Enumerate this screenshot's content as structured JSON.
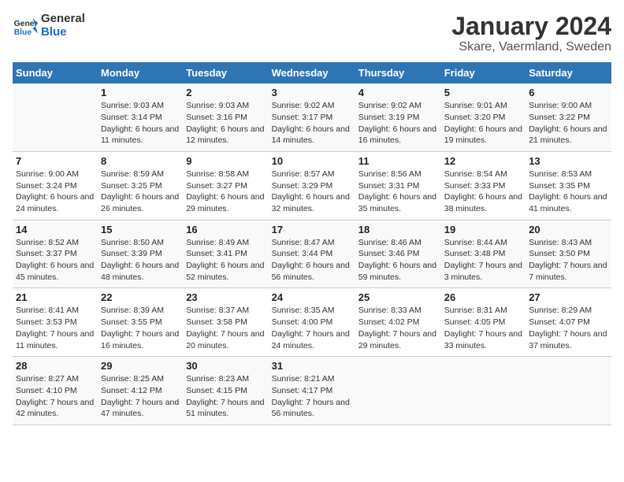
{
  "logo": {
    "text_general": "General",
    "text_blue": "Blue"
  },
  "title": "January 2024",
  "subtitle": "Skare, Vaermland, Sweden",
  "columns": [
    "Sunday",
    "Monday",
    "Tuesday",
    "Wednesday",
    "Thursday",
    "Friday",
    "Saturday"
  ],
  "weeks": [
    [
      {
        "day": "",
        "sunrise": "",
        "sunset": "",
        "daylight": ""
      },
      {
        "day": "1",
        "sunrise": "Sunrise: 9:03 AM",
        "sunset": "Sunset: 3:14 PM",
        "daylight": "Daylight: 6 hours and 11 minutes."
      },
      {
        "day": "2",
        "sunrise": "Sunrise: 9:03 AM",
        "sunset": "Sunset: 3:16 PM",
        "daylight": "Daylight: 6 hours and 12 minutes."
      },
      {
        "day": "3",
        "sunrise": "Sunrise: 9:02 AM",
        "sunset": "Sunset: 3:17 PM",
        "daylight": "Daylight: 6 hours and 14 minutes."
      },
      {
        "day": "4",
        "sunrise": "Sunrise: 9:02 AM",
        "sunset": "Sunset: 3:19 PM",
        "daylight": "Daylight: 6 hours and 16 minutes."
      },
      {
        "day": "5",
        "sunrise": "Sunrise: 9:01 AM",
        "sunset": "Sunset: 3:20 PM",
        "daylight": "Daylight: 6 hours and 19 minutes."
      },
      {
        "day": "6",
        "sunrise": "Sunrise: 9:00 AM",
        "sunset": "Sunset: 3:22 PM",
        "daylight": "Daylight: 6 hours and 21 minutes."
      }
    ],
    [
      {
        "day": "7",
        "sunrise": "Sunrise: 9:00 AM",
        "sunset": "Sunset: 3:24 PM",
        "daylight": "Daylight: 6 hours and 24 minutes."
      },
      {
        "day": "8",
        "sunrise": "Sunrise: 8:59 AM",
        "sunset": "Sunset: 3:25 PM",
        "daylight": "Daylight: 6 hours and 26 minutes."
      },
      {
        "day": "9",
        "sunrise": "Sunrise: 8:58 AM",
        "sunset": "Sunset: 3:27 PM",
        "daylight": "Daylight: 6 hours and 29 minutes."
      },
      {
        "day": "10",
        "sunrise": "Sunrise: 8:57 AM",
        "sunset": "Sunset: 3:29 PM",
        "daylight": "Daylight: 6 hours and 32 minutes."
      },
      {
        "day": "11",
        "sunrise": "Sunrise: 8:56 AM",
        "sunset": "Sunset: 3:31 PM",
        "daylight": "Daylight: 6 hours and 35 minutes."
      },
      {
        "day": "12",
        "sunrise": "Sunrise: 8:54 AM",
        "sunset": "Sunset: 3:33 PM",
        "daylight": "Daylight: 6 hours and 38 minutes."
      },
      {
        "day": "13",
        "sunrise": "Sunrise: 8:53 AM",
        "sunset": "Sunset: 3:35 PM",
        "daylight": "Daylight: 6 hours and 41 minutes."
      }
    ],
    [
      {
        "day": "14",
        "sunrise": "Sunrise: 8:52 AM",
        "sunset": "Sunset: 3:37 PM",
        "daylight": "Daylight: 6 hours and 45 minutes."
      },
      {
        "day": "15",
        "sunrise": "Sunrise: 8:50 AM",
        "sunset": "Sunset: 3:39 PM",
        "daylight": "Daylight: 6 hours and 48 minutes."
      },
      {
        "day": "16",
        "sunrise": "Sunrise: 8:49 AM",
        "sunset": "Sunset: 3:41 PM",
        "daylight": "Daylight: 6 hours and 52 minutes."
      },
      {
        "day": "17",
        "sunrise": "Sunrise: 8:47 AM",
        "sunset": "Sunset: 3:44 PM",
        "daylight": "Daylight: 6 hours and 56 minutes."
      },
      {
        "day": "18",
        "sunrise": "Sunrise: 8:46 AM",
        "sunset": "Sunset: 3:46 PM",
        "daylight": "Daylight: 6 hours and 59 minutes."
      },
      {
        "day": "19",
        "sunrise": "Sunrise: 8:44 AM",
        "sunset": "Sunset: 3:48 PM",
        "daylight": "Daylight: 7 hours and 3 minutes."
      },
      {
        "day": "20",
        "sunrise": "Sunrise: 8:43 AM",
        "sunset": "Sunset: 3:50 PM",
        "daylight": "Daylight: 7 hours and 7 minutes."
      }
    ],
    [
      {
        "day": "21",
        "sunrise": "Sunrise: 8:41 AM",
        "sunset": "Sunset: 3:53 PM",
        "daylight": "Daylight: 7 hours and 11 minutes."
      },
      {
        "day": "22",
        "sunrise": "Sunrise: 8:39 AM",
        "sunset": "Sunset: 3:55 PM",
        "daylight": "Daylight: 7 hours and 16 minutes."
      },
      {
        "day": "23",
        "sunrise": "Sunrise: 8:37 AM",
        "sunset": "Sunset: 3:58 PM",
        "daylight": "Daylight: 7 hours and 20 minutes."
      },
      {
        "day": "24",
        "sunrise": "Sunrise: 8:35 AM",
        "sunset": "Sunset: 4:00 PM",
        "daylight": "Daylight: 7 hours and 24 minutes."
      },
      {
        "day": "25",
        "sunrise": "Sunrise: 8:33 AM",
        "sunset": "Sunset: 4:02 PM",
        "daylight": "Daylight: 7 hours and 29 minutes."
      },
      {
        "day": "26",
        "sunrise": "Sunrise: 8:31 AM",
        "sunset": "Sunset: 4:05 PM",
        "daylight": "Daylight: 7 hours and 33 minutes."
      },
      {
        "day": "27",
        "sunrise": "Sunrise: 8:29 AM",
        "sunset": "Sunset: 4:07 PM",
        "daylight": "Daylight: 7 hours and 37 minutes."
      }
    ],
    [
      {
        "day": "28",
        "sunrise": "Sunrise: 8:27 AM",
        "sunset": "Sunset: 4:10 PM",
        "daylight": "Daylight: 7 hours and 42 minutes."
      },
      {
        "day": "29",
        "sunrise": "Sunrise: 8:25 AM",
        "sunset": "Sunset: 4:12 PM",
        "daylight": "Daylight: 7 hours and 47 minutes."
      },
      {
        "day": "30",
        "sunrise": "Sunrise: 8:23 AM",
        "sunset": "Sunset: 4:15 PM",
        "daylight": "Daylight: 7 hours and 51 minutes."
      },
      {
        "day": "31",
        "sunrise": "Sunrise: 8:21 AM",
        "sunset": "Sunset: 4:17 PM",
        "daylight": "Daylight: 7 hours and 56 minutes."
      },
      {
        "day": "",
        "sunrise": "",
        "sunset": "",
        "daylight": ""
      },
      {
        "day": "",
        "sunrise": "",
        "sunset": "",
        "daylight": ""
      },
      {
        "day": "",
        "sunrise": "",
        "sunset": "",
        "daylight": ""
      }
    ]
  ]
}
